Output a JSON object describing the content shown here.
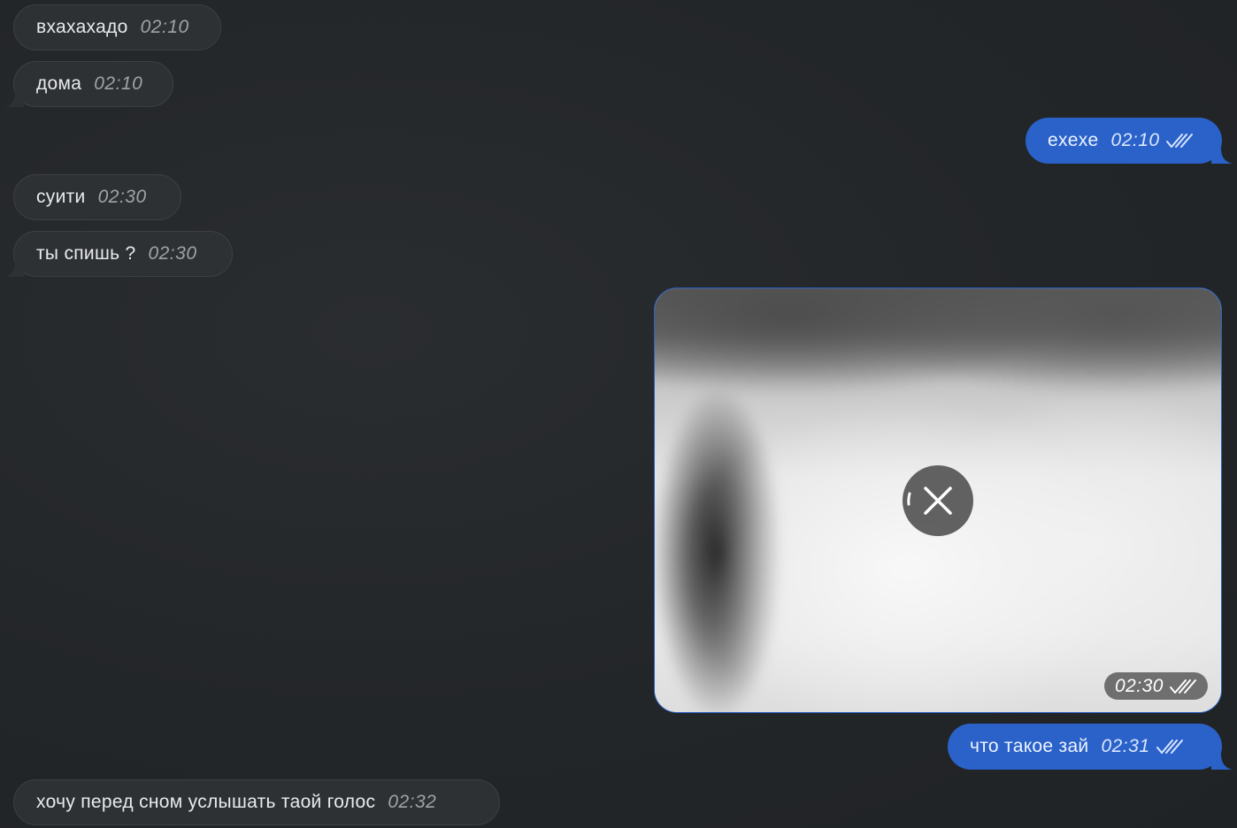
{
  "messages": [
    {
      "text": "вхахахадо",
      "time": "02:10"
    },
    {
      "text": "дома",
      "time": "02:10"
    },
    {
      "text": "exexe",
      "time": "02:10"
    },
    {
      "text": "суити",
      "time": "02:30"
    },
    {
      "text": "ты спишь ?",
      "time": "02:30"
    },
    {
      "time": "02:30"
    },
    {
      "text": "что такое зай",
      "time": "02:31"
    },
    {
      "text": "хочу перед сном услышать таой голос",
      "time": "02:32"
    }
  ],
  "colors": {
    "background": "#232629",
    "incoming_bubble": "#2e3134",
    "outgoing_bubble": "#2a62c9"
  },
  "icons": {
    "read_receipt": "double-check-icon",
    "cancel_download": "close-icon"
  }
}
